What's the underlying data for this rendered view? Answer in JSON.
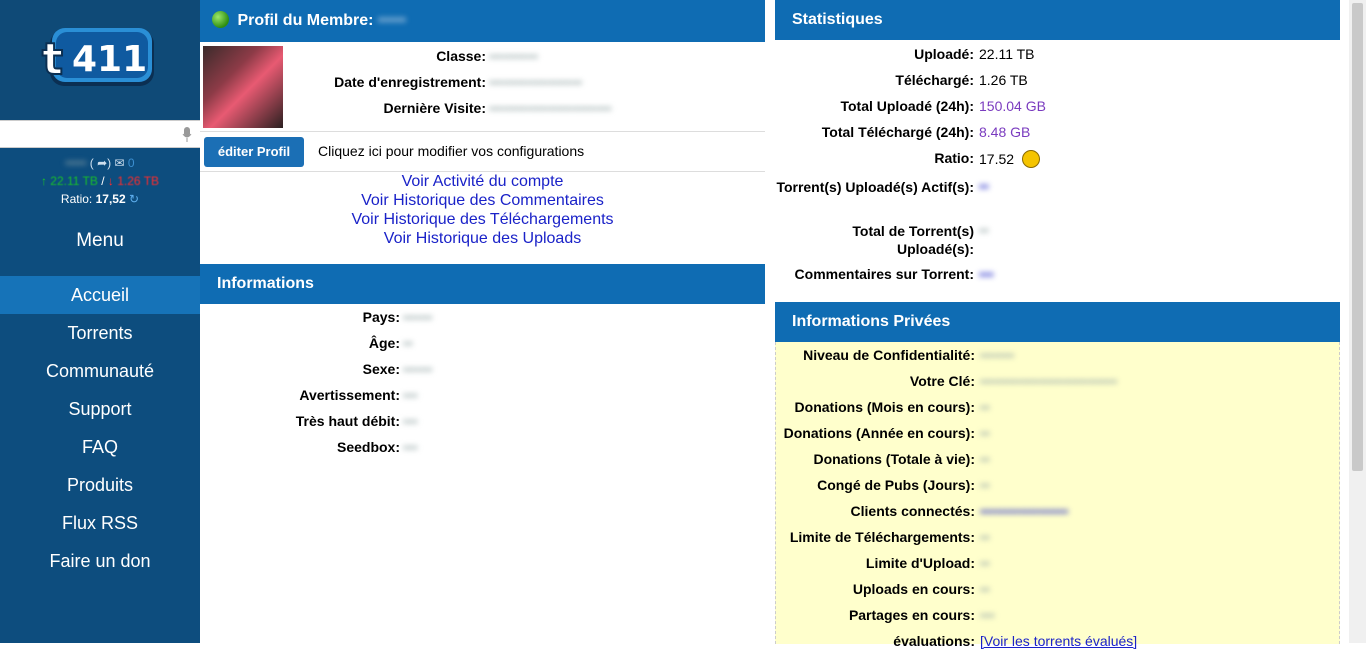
{
  "sidebar": {
    "logo_text": "t411",
    "user_stats": {
      "username": "•••••",
      "upload": "22.11 TB",
      "sep": "/",
      "download": "1.26 TB",
      "mail_count": "0",
      "ratio_label": "Ratio:",
      "ratio_value": "17,52"
    },
    "menu_title": "Menu",
    "menu": [
      "Accueil",
      "Torrents",
      "Communauté",
      "Support",
      "FAQ",
      "Produits",
      "Flux RSS",
      "Faire un don"
    ]
  },
  "profile": {
    "header": "Profil du Membre:",
    "username_blur": "•••••",
    "fields": [
      {
        "label": "Classe:",
        "value": "••••••••••"
      },
      {
        "label": "Date d'enregistrement:",
        "value": "•••••••••••••••••••"
      },
      {
        "label": "Dernière Visite:",
        "value": "•••••••••••••••••••••••••"
      }
    ],
    "edit_button": "éditer Profil",
    "edit_hint": "Cliquez ici pour modifier vos configurations",
    "links": [
      "Voir Activité du compte",
      "Voir Historique des Commentaires",
      "Voir Historique des Téléchargements",
      "Voir Historique des Uploads"
    ]
  },
  "informations": {
    "header": "Informations",
    "rows": [
      {
        "label": "Pays:",
        "value": "••••••"
      },
      {
        "label": "Âge:",
        "value": "••"
      },
      {
        "label": "Sexe:",
        "value": "••••••"
      },
      {
        "label": "Avertissement:",
        "value": "•••"
      },
      {
        "label": "Très haut débit:",
        "value": "•••"
      },
      {
        "label": "Seedbox:",
        "value": "•••"
      }
    ]
  },
  "statistiques": {
    "header": "Statistiques",
    "rows": [
      {
        "label": "Uploadé:",
        "value": "22.11 TB"
      },
      {
        "label": "Téléchargé:",
        "value": "1.26 TB"
      },
      {
        "label": "Total Uploadé (24h):",
        "value": "150.04 GB"
      },
      {
        "label": "Total Téléchargé (24h):",
        "value": "8.48 GB"
      },
      {
        "label": "Ratio:",
        "value": "17.52"
      },
      {
        "label": "Torrent(s) Uploadé(s) Actif(s):",
        "value": "••"
      },
      {
        "label": "Total de Torrent(s) Uploadé(s):",
        "value": "••"
      },
      {
        "label": "Commentaires sur Torrent:",
        "value": "•••"
      }
    ]
  },
  "privees": {
    "header": "Informations Privées",
    "rows": [
      {
        "label": "Niveau de Confidentialité:",
        "value": "•••••••"
      },
      {
        "label": "Votre Clé:",
        "value": "••••••••••••••••••••••••••••"
      },
      {
        "label": "Donations (Mois en cours):",
        "value": "••"
      },
      {
        "label": "Donations (Année en cours):",
        "value": "••"
      },
      {
        "label": "Donations (Totale à vie):",
        "value": "••"
      },
      {
        "label": "Congé de Pubs (Jours):",
        "value": "••"
      },
      {
        "label": "Clients connectés:",
        "value": "••••••••••••••••••"
      },
      {
        "label": "Limite de Téléchargements:",
        "value": "••"
      },
      {
        "label": "Limite d'Upload:",
        "value": "••"
      },
      {
        "label": "Uploads en cours:",
        "value": "••"
      },
      {
        "label": "Partages en cours:",
        "value": "•••"
      },
      {
        "label": "évaluations:",
        "value": "[Voir les torrents évalués]"
      }
    ]
  }
}
